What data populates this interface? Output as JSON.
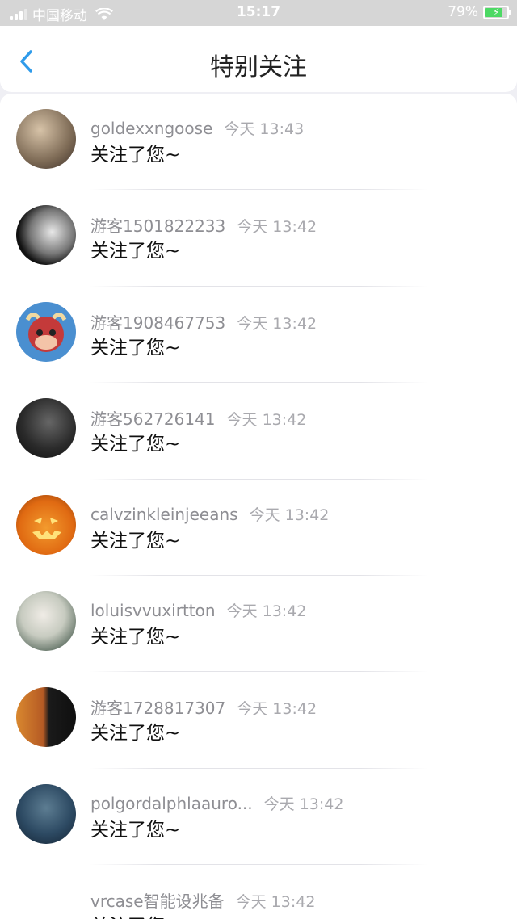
{
  "status_bar": {
    "carrier": "中国移动",
    "time": "15:17",
    "battery": "79%"
  },
  "header": {
    "title": "特别关注",
    "back_icon": "chevron-left-icon"
  },
  "accent_color": "#2f9bea",
  "items": [
    {
      "name": "goldexxngoose",
      "time": "今天 13:43",
      "message": "关注了您~"
    },
    {
      "name": "游客1501822233",
      "time": "今天 13:42",
      "message": "关注了您~"
    },
    {
      "name": "游客1908467753",
      "time": "今天 13:42",
      "message": "关注了您~"
    },
    {
      "name": "游客562726141",
      "time": "今天 13:42",
      "message": "关注了您~"
    },
    {
      "name": "calvzinkleinjeeans",
      "time": "今天 13:42",
      "message": "关注了您~"
    },
    {
      "name": "loluisvvuxirtton",
      "time": "今天 13:42",
      "message": "关注了您~"
    },
    {
      "name": "游客1728817307",
      "time": "今天 13:42",
      "message": "关注了您~"
    },
    {
      "name": "polgordalphlaauro...",
      "time": "今天 13:42",
      "message": "关注了您~"
    },
    {
      "name": "vrcase智能设兆备",
      "time": "今天 13:42",
      "message": "关注了您~"
    }
  ]
}
